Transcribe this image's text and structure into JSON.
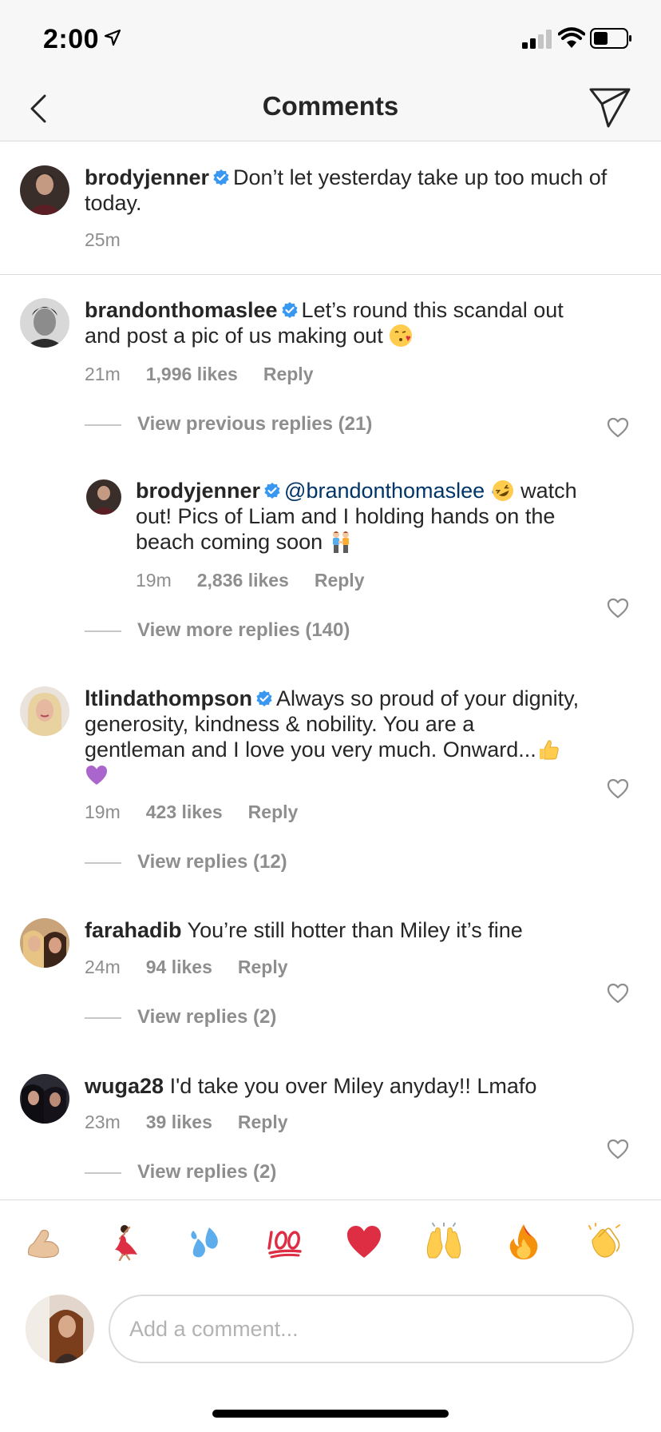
{
  "status_bar": {
    "time": "2:00"
  },
  "nav": {
    "title": "Comments"
  },
  "caption": {
    "username": "brodyjenner",
    "text": "Don’t let yesterday take up too much of today.",
    "time": "25m"
  },
  "comments": [
    {
      "username": "brandonthomaslee",
      "text": "Let’s round this scandal out and post a pic of us making out",
      "time": "21m",
      "likes": "1,996 likes",
      "reply": "Reply",
      "view_replies": "View previous replies (21)"
    },
    {
      "username": "brodyjenner",
      "mention": "@brandonthomaslee",
      "text": "watch out! Pics of Liam and I holding hands on the beach coming soon",
      "time": "19m",
      "likes": "2,836 likes",
      "reply": "Reply",
      "view_replies": "View more replies (140)"
    },
    {
      "username": "ltlindathompson",
      "text": "Always so proud of your dignity, generosity, kindness & nobility. You are a gentleman and I love you very much. Onward...",
      "time": "19m",
      "likes": "423 likes",
      "reply": "Reply",
      "view_replies": "View replies (12)"
    },
    {
      "username": "farahadib",
      "text": "You’re still hotter than Miley it’s fine",
      "time": "24m",
      "likes": "94 likes",
      "reply": "Reply",
      "view_replies": "View replies (2)"
    },
    {
      "username": "wuga28",
      "text": "I'd take you over Miley anyday!! Lmafo",
      "time": "23m",
      "likes": "39 likes",
      "reply": "Reply",
      "view_replies": "View replies (2)"
    }
  ],
  "emoji_bar": [
    "flexed-biceps",
    "dancer",
    "sweat-droplets",
    "hundred-points",
    "red-heart",
    "raising-hands",
    "fire",
    "clapping-hands"
  ],
  "composer": {
    "placeholder": "Add a comment..."
  },
  "colors": {
    "text": "#262626",
    "meta": "#8e8e8e",
    "verified": "#3897f0",
    "mention": "#003569"
  }
}
